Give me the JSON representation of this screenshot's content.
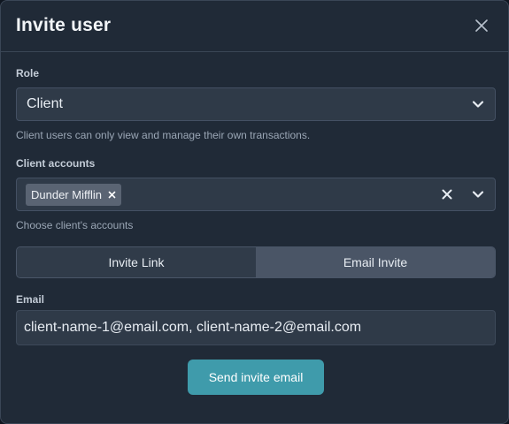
{
  "modal": {
    "title": "Invite user"
  },
  "role": {
    "label": "Role",
    "value": "Client",
    "helper": "Client users can only view and manage their own transactions."
  },
  "client_accounts": {
    "label": "Client accounts",
    "selected": [
      "Dunder Mifflin"
    ],
    "helper": "Choose client's accounts"
  },
  "invite_tabs": [
    {
      "label": "Invite Link",
      "active": false
    },
    {
      "label": "Email Invite",
      "active": true
    }
  ],
  "email": {
    "label": "Email",
    "value": "client-name-1@email.com, client-name-2@email.com"
  },
  "send_button": {
    "label": "Send invite email"
  },
  "colors": {
    "accent": "#3f9bab",
    "background": "#202a37"
  }
}
